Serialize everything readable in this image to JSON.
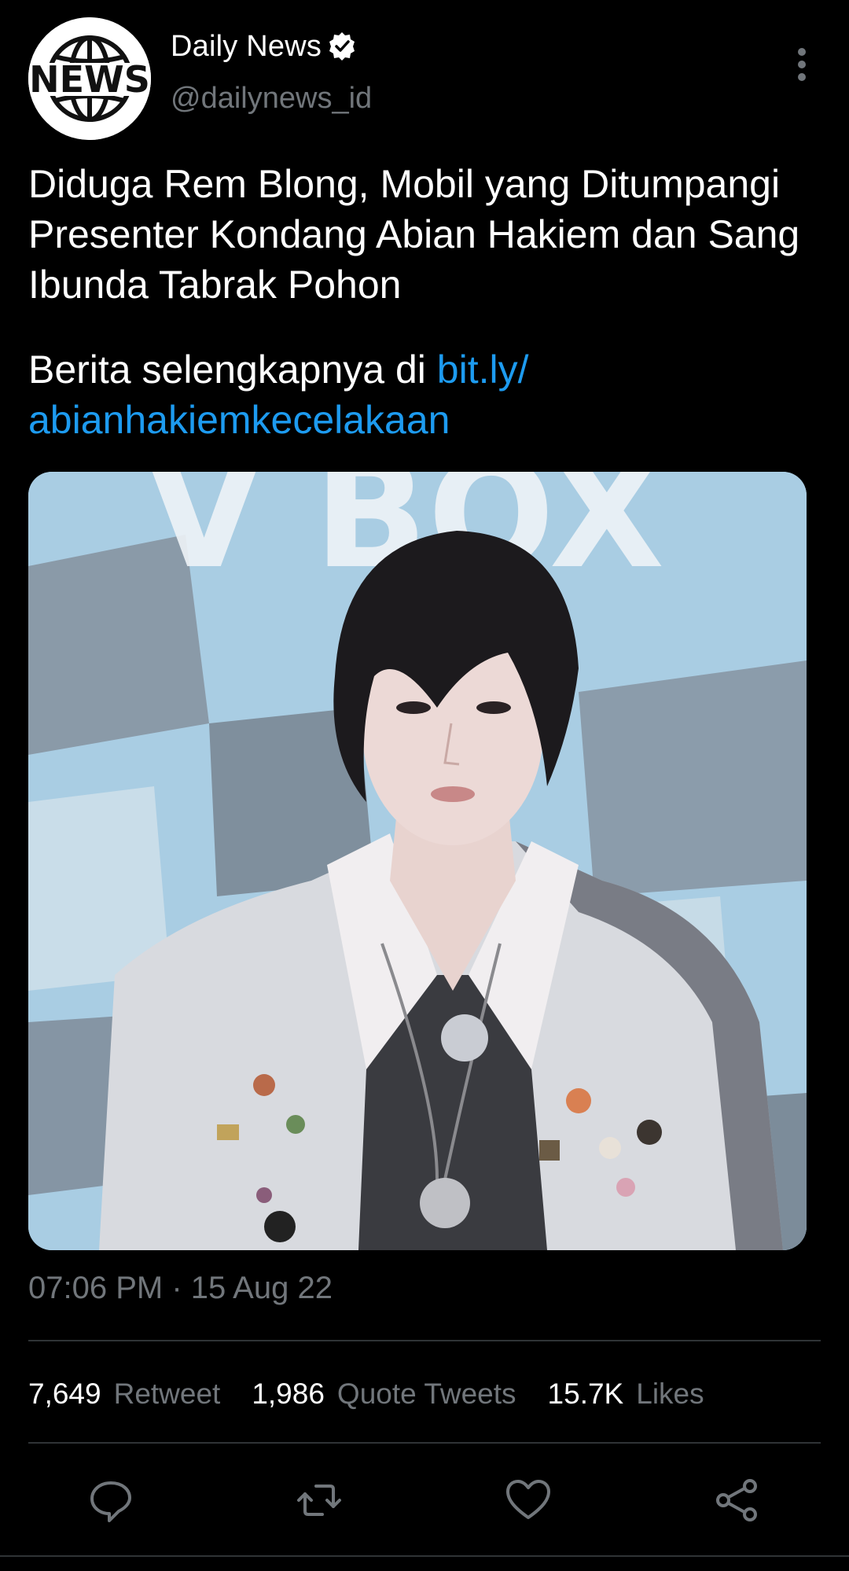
{
  "account": {
    "display_name": "Daily News",
    "handle": "@dailynews_id",
    "avatar_text": "NEWS",
    "verified": true
  },
  "tweet": {
    "headline": "Diduga Rem Blong, Mobil yang Ditumpangi Presenter Kondang Abian Hakiem dan Sang Ibunda Tabrak Pohon",
    "more_prefix": "Berita selengkapnya di ",
    "link_text": "bit.ly/ abianhakiemkecelakaan",
    "timestamp": "07:06 PM · 15 Aug 22"
  },
  "stats": {
    "retweets_count": "7,649",
    "retweets_label": "Retweet",
    "quotes_count": "1,986",
    "quotes_label": "Quote Tweets",
    "likes_count": "15.7K",
    "likes_label": "Likes"
  },
  "actions": {
    "reply_icon": "reply-icon",
    "retweet_icon": "retweet-icon",
    "like_icon": "heart-icon",
    "share_icon": "share-icon"
  },
  "colors": {
    "background": "#000000",
    "link": "#1d9bf0",
    "secondary_text": "#71767b",
    "divider": "#2f3336"
  }
}
